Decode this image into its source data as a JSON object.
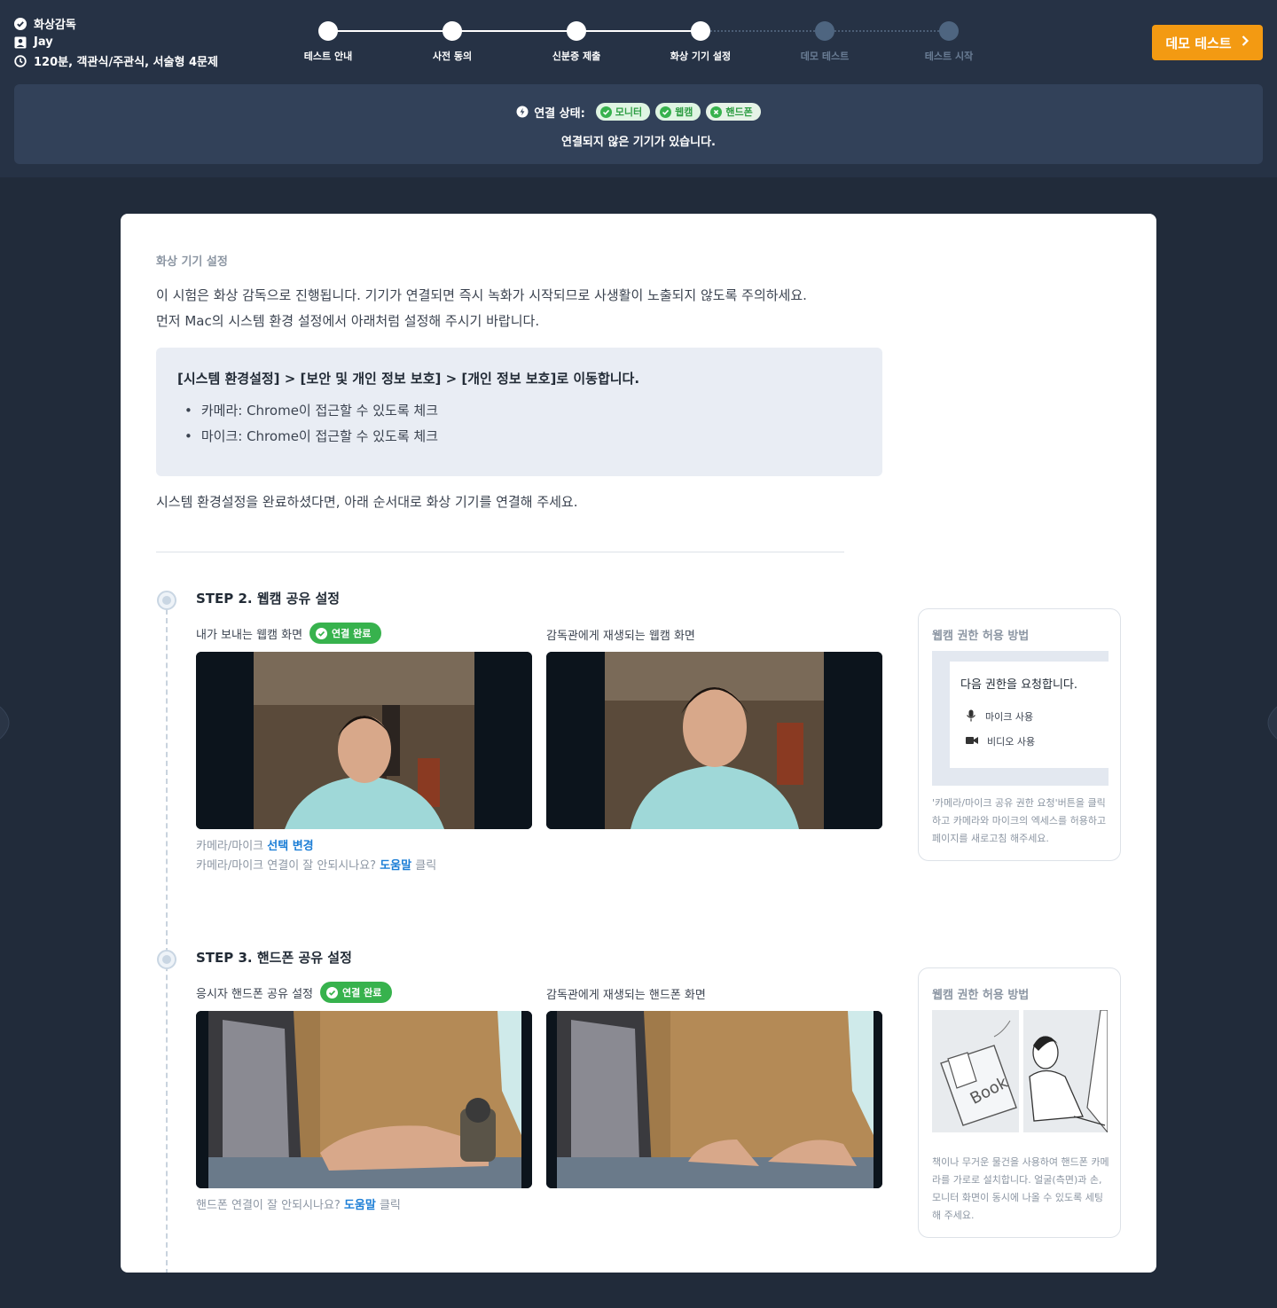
{
  "header": {
    "exam_type": "화상감독",
    "user_name": "Jay",
    "exam_info": "120분, 객관식/주관식, 서술형 4문제",
    "steps": [
      {
        "label": "테스트 안내",
        "state": "done"
      },
      {
        "label": "사전 동의",
        "state": "done"
      },
      {
        "label": "신분증 제출",
        "state": "done"
      },
      {
        "label": "화상 기기 설정",
        "state": "done"
      },
      {
        "label": "데모 테스트",
        "state": "todo"
      },
      {
        "label": "테스트 시작",
        "state": "todo"
      }
    ],
    "demo_button": "데모 테스트"
  },
  "connection": {
    "label": "연결 상태:",
    "devices": [
      {
        "name": "모니터",
        "status": "ok"
      },
      {
        "name": "웹캠",
        "status": "ok"
      },
      {
        "name": "핸드폰",
        "status": "not-connected"
      }
    ],
    "message": "연결되지 않은 기기가 있습니다."
  },
  "content": {
    "section_title": "화상 기기 설정",
    "intro_line1": "이 시험은 화상 감독으로 진행됩니다. 기기가 연결되면 즉시 녹화가 시작되므로 사생활이 노출되지 않도록 주의하세요.",
    "intro_line2": "먼저 Mac의 시스템 환경 설정에서 아래처럼 설정해 주시기 바랍니다.",
    "info_title": "[시스템 환경설정] > [보안 및 개인 정보 보호] > [개인 정보 보호]로 이동합니다.",
    "info_items": [
      "카메라: Chrome이 접근할 수 있도록 체크",
      "마이크: Chrome이 접근할 수 있도록 체크"
    ],
    "after_text": "시스템 환경설정을 완료하셨다면, 아래 순서대로 화상 기기를 연결해 주세요."
  },
  "step2": {
    "title": "STEP 2. 웹캠 공유 설정",
    "left_label": "내가 보내는 웹캠 화면",
    "badge": "연결 완료",
    "right_label": "감독관에게 재생되는 웹캠 화면",
    "hint1_prefix": "카메라/마이크 ",
    "hint1_link": "선택 변경",
    "hint2_prefix": "카메라/마이크 연결이 잘 안되시나요? ",
    "hint2_link": "도움말",
    "hint2_suffix": " 클릭",
    "help_title": "웹캠 권한 허용 방법",
    "perm_title": "다음 권한을 요청합니다.",
    "perm_mic": "마이크 사용",
    "perm_video": "비디오 사용",
    "help_desc": "'카메라/마이크 공유 권한 요청'버튼을 클릭하고 카메라와 마이크의 엑세스를 허용하고 페이지를 새로고침 해주세요."
  },
  "step3": {
    "title": "STEP 3. 핸드폰 공유 설정",
    "left_label": "응시자 핸드폰 공유 설정",
    "badge": "연결 완료",
    "right_label": "감독관에게 재생되는 핸드폰 화면",
    "hint_prefix": "핸드폰 연결이 잘 안되시나요? ",
    "hint_link": "도움말",
    "hint_suffix": " 클릭",
    "help_title": "웹캠 권한 허용 방법",
    "illus_text": "Book",
    "help_desc": "책이나 무거운 물건을 사용하여 핸드폰 카메라를 가로로 설치합니다. 얼굴(측면)과 손, 모니터 화면이 동시에 나올 수 있도록 세팅해 주세요."
  }
}
